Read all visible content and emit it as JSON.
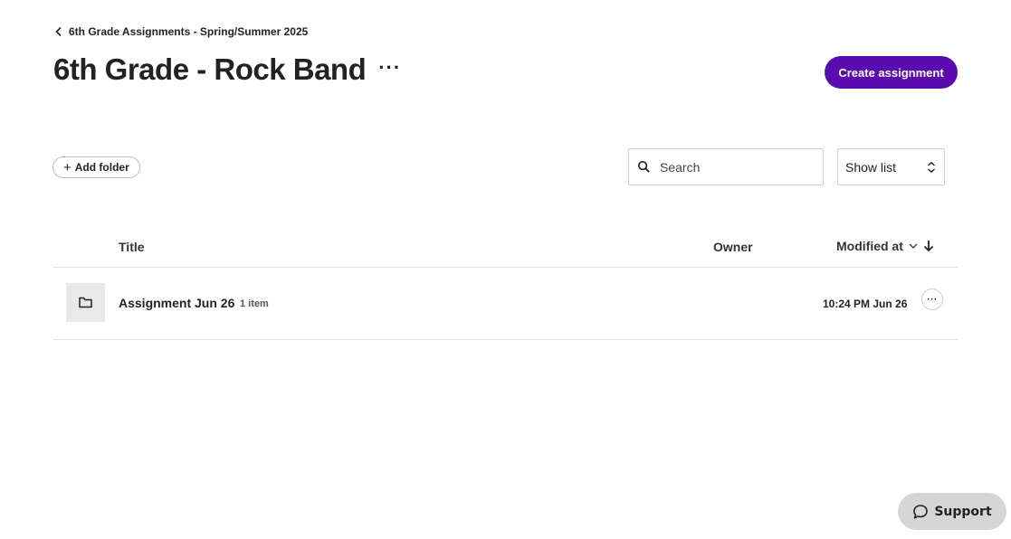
{
  "breadcrumb": {
    "label": "6th Grade Assignments - Spring/Summer 2025",
    "icon": "chevron-left-icon"
  },
  "header": {
    "title": "6th Grade - Rock Band",
    "more_label": "···",
    "create_label": "Create assignment"
  },
  "toolbar": {
    "add_folder_plus": "+",
    "add_folder_label": "Add folder",
    "search_placeholder": "Search",
    "view_select_value": "Show list"
  },
  "table": {
    "columns": {
      "title": "Title",
      "owner": "Owner",
      "modified": "Modified at"
    },
    "rows": [
      {
        "title": "Assignment Jun 26",
        "count": "1 item",
        "owner": "",
        "modified": "10:24 PM Jun 26",
        "more_label": "···",
        "icon": "folder-icon"
      }
    ]
  },
  "support": {
    "label": "Support",
    "icon": "chat-bubble-icon"
  },
  "colors": {
    "accent": "#5b0cb0",
    "support_bg": "#d6d6d6"
  }
}
